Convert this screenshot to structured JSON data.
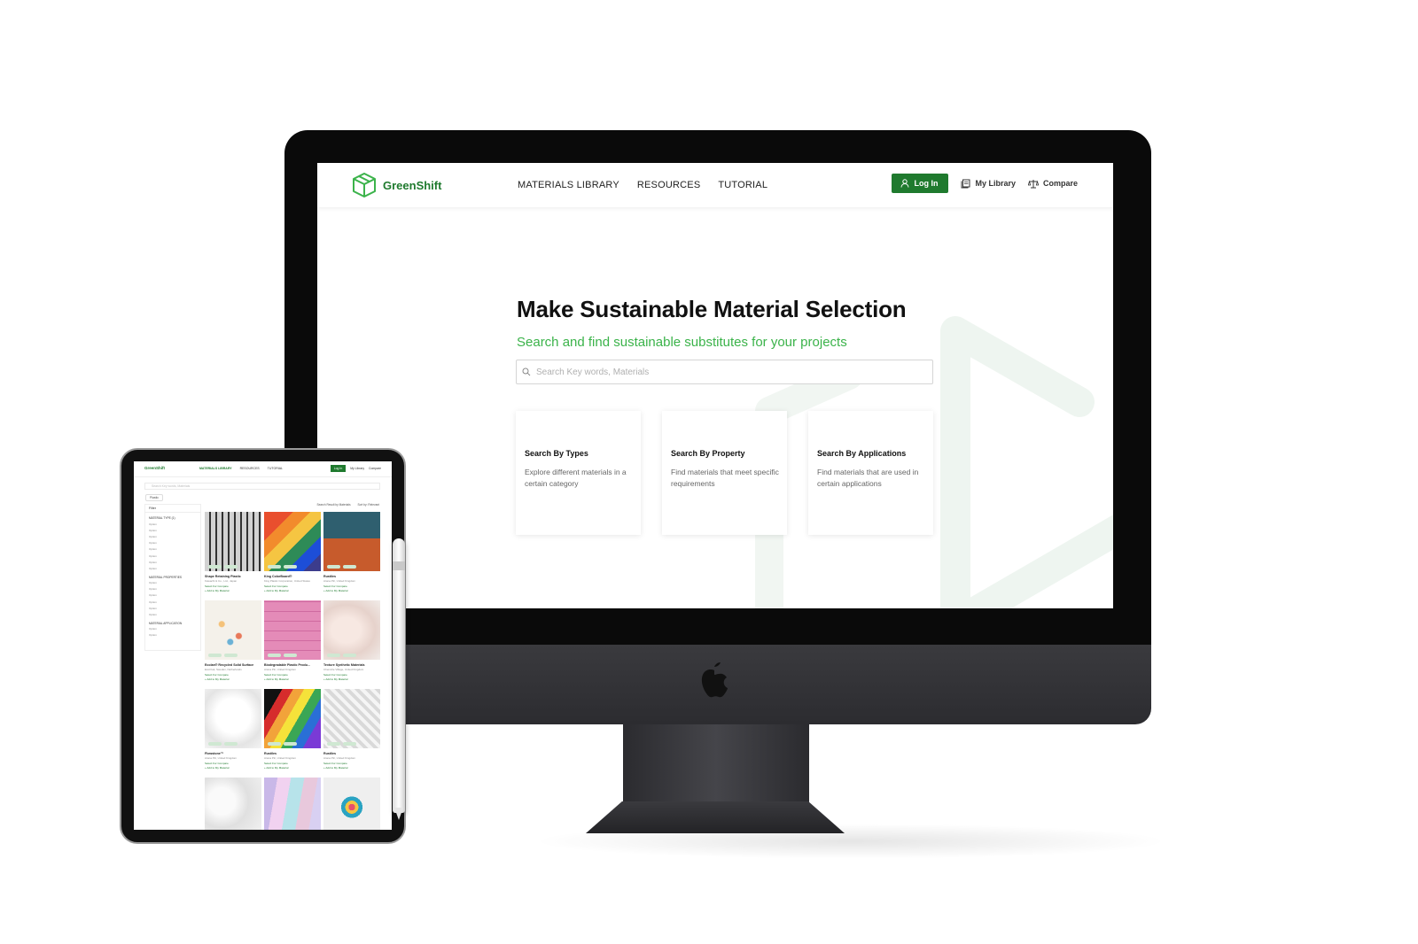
{
  "desktop": {
    "brand": "GreenShift",
    "nav": [
      "MATERIALS LIBRARY",
      "RESOURCES",
      "TUTORIAL"
    ],
    "login": "Log In",
    "my_library": "My Library",
    "compare": "Compare",
    "hero_title": "Make Sustainable Material Selection",
    "hero_subtitle": "Search and find sustainable substitutes for your projects",
    "search_placeholder": "Search Key words, Materials",
    "cards": [
      {
        "title": "Search By Types",
        "desc": "Explore different materials in a certain category"
      },
      {
        "title": "Search By Property",
        "desc": "Find materials that meet specific requirements"
      },
      {
        "title": "Search By Applications",
        "desc": "Find materials that are used in certain applications"
      }
    ],
    "accent": "#1f7a2e",
    "accent_light": "#3bb34a"
  },
  "tablet": {
    "brand": "GreenShift",
    "nav": [
      "MATERIALS LIBRARY",
      "RESOURCES",
      "TUTORIAL"
    ],
    "login": "Log In",
    "my_library": "My Library",
    "compare": "Compare",
    "search_placeholder": "Search Key words, Materials",
    "chip": "Plastic",
    "filter_header": "Filter",
    "sort_left": "Search Result by Materials",
    "sort_right": "Sort by: Relevant",
    "sections": [
      {
        "label": "MATERIAL TYPE (1)",
        "options": [
          "Option",
          "Option",
          "Option",
          "Option",
          "Option",
          "Option",
          "Option",
          "Option"
        ]
      },
      {
        "label": "MATERIAL PROPERTIES",
        "options": [
          "Option",
          "Option",
          "Option",
          "Option",
          "Option",
          "Option"
        ]
      },
      {
        "label": "MATERIAL APPLICATION",
        "options": [
          "Option",
          "Option"
        ]
      }
    ],
    "products": [
      {
        "name": "Shape Retaining Plastic",
        "meta": "Kawachi & Co., Ltd., Japan"
      },
      {
        "name": "King ColorBoard®",
        "meta": "King Plastic Corporation, United States"
      },
      {
        "name": "Rustiles",
        "meta": "Arana Plc, United Kingdom"
      },
      {
        "name": "Ecolan® Recycled Solid Surface",
        "meta": "EcoOval, Sweden, Netherlands"
      },
      {
        "name": "Biodegradable Plastic Produ...",
        "meta": "Arana Plc, United Kingdom"
      },
      {
        "name": "Texture Synthetic Materials",
        "meta": "Chemicle Village, United Kingdom"
      },
      {
        "name": "Flowstone™",
        "meta": "Arana Plc, United Kingdom"
      },
      {
        "name": "Rustiles",
        "meta": "Arana Plc, United Kingdom"
      },
      {
        "name": "Rustiles",
        "meta": "Arana Plc, United Kingdom"
      }
    ],
    "compare_label": "Select For Compare",
    "add_library_label": "+  Add to My Material"
  }
}
